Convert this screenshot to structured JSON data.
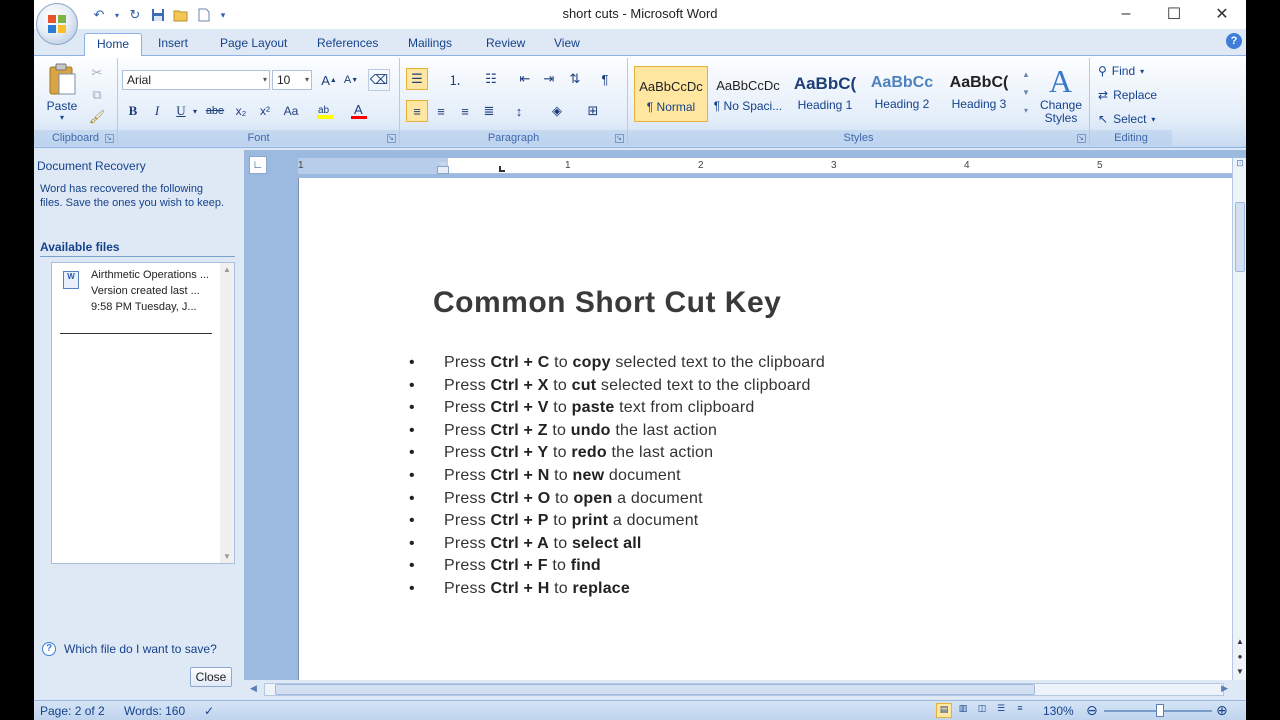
{
  "window": {
    "title": "short cuts - Microsoft Word",
    "minimize": "–",
    "maximize": "☐",
    "close": "✕"
  },
  "tabs": [
    "Home",
    "Insert",
    "Page Layout",
    "References",
    "Mailings",
    "Review",
    "View"
  ],
  "ribbon": {
    "clipboard": {
      "paste": "Paste",
      "label": "Clipboard"
    },
    "font": {
      "name": "Arial",
      "size": "10",
      "label": "Font",
      "buttons": {
        "bold": "B",
        "italic": "I",
        "underline": "U",
        "strike": "abe",
        "sub": "x₂",
        "sup": "x²",
        "case": "Aa"
      }
    },
    "paragraph": {
      "label": "Paragraph"
    },
    "styles": {
      "label": "Styles",
      "items": [
        {
          "sample": "AaBbCcDc",
          "name": "¶ Normal"
        },
        {
          "sample": "AaBbCcDc",
          "name": "¶ No Spaci..."
        },
        {
          "sample": "AaBbC(",
          "name": "Heading 1"
        },
        {
          "sample": "AaBbCc",
          "name": "Heading 2"
        },
        {
          "sample": "AaBbC(",
          "name": "Heading 3"
        }
      ],
      "change_styles": "Change Styles"
    },
    "editing": {
      "label": "Editing",
      "find": "Find",
      "replace": "Replace",
      "select": "Select"
    }
  },
  "recovery": {
    "title": "Document Recovery",
    "description": "Word has recovered the following files.  Save the ones you wish to keep.",
    "available": "Available files",
    "file": {
      "line1": "Airthmetic Operations ...",
      "line2": "Version created last ...",
      "line3": "9:58 PM Tuesday, J..."
    },
    "help": "Which file do I want to save?",
    "close": "Close"
  },
  "ruler": {
    "numbers": [
      "1",
      "1",
      "2",
      "3",
      "4",
      "5"
    ]
  },
  "document": {
    "title": "Common Short Cut Key",
    "items": [
      {
        "pre": "Press ",
        "key": "Ctrl + C",
        "mid": " to ",
        "action": "copy",
        "post": " selected text to the clipboard"
      },
      {
        "pre": "Press ",
        "key": "Ctrl + X",
        "mid": " to ",
        "action": "cut",
        "post": " selected text to the clipboard"
      },
      {
        "pre": "Press ",
        "key": "Ctrl + V",
        "mid": " to ",
        "action": "paste",
        "post": " text from clipboard"
      },
      {
        "pre": "Press ",
        "key": "Ctrl + Z",
        "mid": " to ",
        "action": "undo",
        "post": " the last action"
      },
      {
        "pre": "Press ",
        "key": "Ctrl + Y",
        "mid": " to ",
        "action": "redo",
        "post": " the last action"
      },
      {
        "pre": "Press ",
        "key": "Ctrl + N",
        "mid": " to ",
        "action": "new",
        "post": " document"
      },
      {
        "pre": "Press ",
        "key": "Ctrl + O",
        "mid": " to ",
        "action": "open",
        "post": " a document"
      },
      {
        "pre": "Press ",
        "key": "Ctrl + P",
        "mid": " to ",
        "action": "print",
        "post": " a document"
      },
      {
        "pre": "Press ",
        "key": "Ctrl + A",
        "mid": " to ",
        "action": "select all",
        "post": ""
      },
      {
        "pre": "Press ",
        "key": "Ctrl + F",
        "mid": " to ",
        "action": "find",
        "post": ""
      },
      {
        "pre": "Press ",
        "key": "Ctrl + H",
        "mid": " to ",
        "action": "replace",
        "post": ""
      }
    ]
  },
  "status": {
    "page": "Page: 2 of 2",
    "words": "Words: 160",
    "zoom": "130%"
  },
  "colors": {
    "ribbon_blue": "#dfe9f5",
    "accent": "#15428b",
    "selected_style": "#ffe7a1"
  }
}
